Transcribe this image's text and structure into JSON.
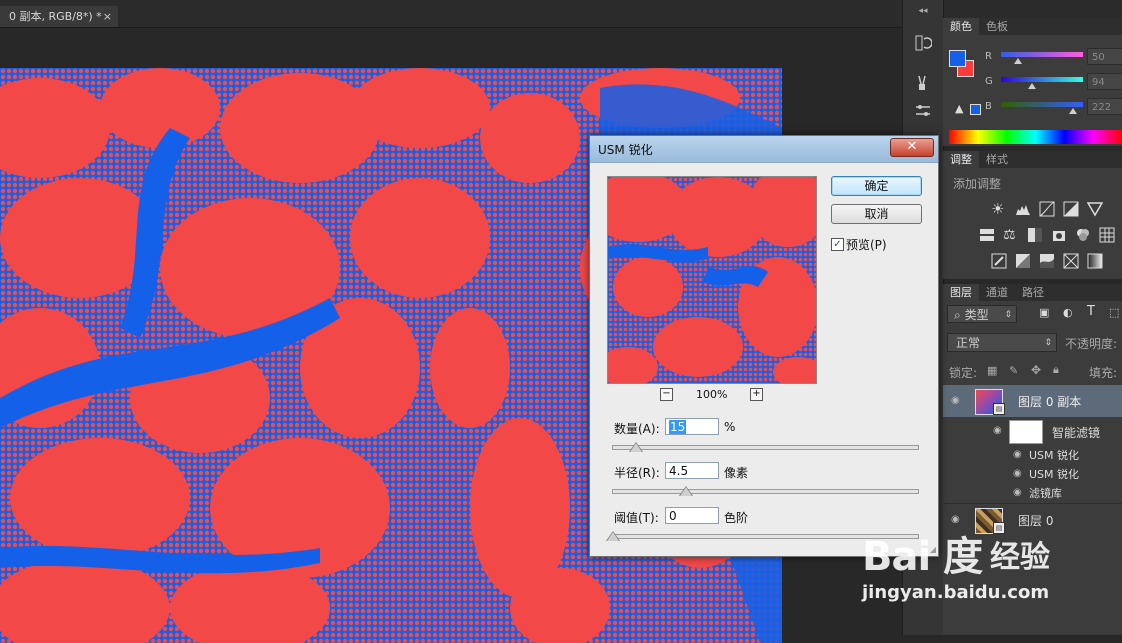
{
  "document": {
    "tab_title": "  0 副本, RGB/8*) *",
    "tab_close": "×"
  },
  "dialog": {
    "title": "USM 锐化",
    "close": "✕",
    "ok_label": "确定",
    "cancel_label": "取消",
    "preview_label": "预览(P)",
    "preview_checked": true,
    "zoom_out": "−",
    "zoom_in": "+",
    "zoom_value": "100%",
    "amount": {
      "label": "数量(A):",
      "value": "15",
      "unit": "%",
      "slider": 0.05
    },
    "radius": {
      "label": "半径(R):",
      "value": "4.5",
      "unit": "像素",
      "slider": 0.24
    },
    "threshold": {
      "label": "阈值(T):",
      "value": "0",
      "unit": "色阶",
      "slider": 0.0
    }
  },
  "color_panel": {
    "tabs": [
      "颜色",
      "色板"
    ],
    "foreground": "#1560e8",
    "background": "#ff3a3a",
    "channels": [
      {
        "label": "R",
        "value": "50"
      },
      {
        "label": "G",
        "value": "94"
      },
      {
        "label": "B",
        "value": "222"
      }
    ]
  },
  "adjustments_panel": {
    "tabs": [
      "调整",
      "样式"
    ],
    "heading": "添加调整"
  },
  "layers_panel": {
    "tabs": [
      "图层",
      "通道",
      "路径"
    ],
    "filter_label": "类型",
    "blend_mode": "正常",
    "opacity_label": "不透明度:",
    "lock_label": "锁定:",
    "fill_label": "填充:",
    "layers": [
      {
        "name": "图层 0 副本"
      },
      {
        "name": "智能滤镜"
      },
      {
        "name": "USM 锐化"
      },
      {
        "name": "USM 锐化"
      },
      {
        "name": "滤镜库"
      },
      {
        "name": "图层 0"
      }
    ]
  },
  "watermark": {
    "logo": "Bai 度",
    "brand_cn": "经验",
    "url": "jingyan.baidu.com"
  }
}
